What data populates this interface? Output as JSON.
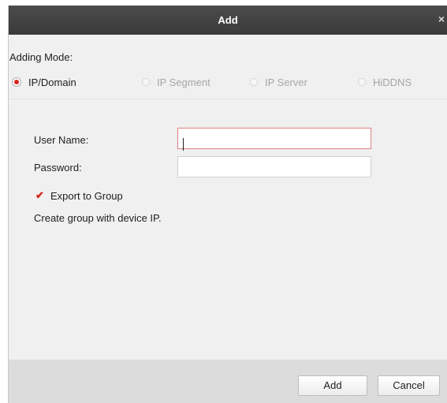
{
  "dialog": {
    "title": "Add",
    "close_glyph": "×"
  },
  "mode": {
    "label": "Adding Mode:",
    "options": [
      {
        "label": "IP/Domain",
        "selected": true
      },
      {
        "label": "IP Segment",
        "selected": false
      },
      {
        "label": "IP Server",
        "selected": false
      },
      {
        "label": "HiDDNS",
        "selected": false
      }
    ]
  },
  "form": {
    "username_label": "User Name:",
    "username_value": "",
    "password_label": "Password:",
    "password_value": "",
    "export_label": "Export to Group",
    "export_checked": true,
    "info": "Create group with device IP."
  },
  "footer": {
    "add_label": "Add",
    "cancel_label": "Cancel"
  },
  "colors": {
    "accent": "#d9261c",
    "titlebar": "#404040",
    "panel": "#f0f0f0",
    "footer": "#dcdcdc"
  }
}
